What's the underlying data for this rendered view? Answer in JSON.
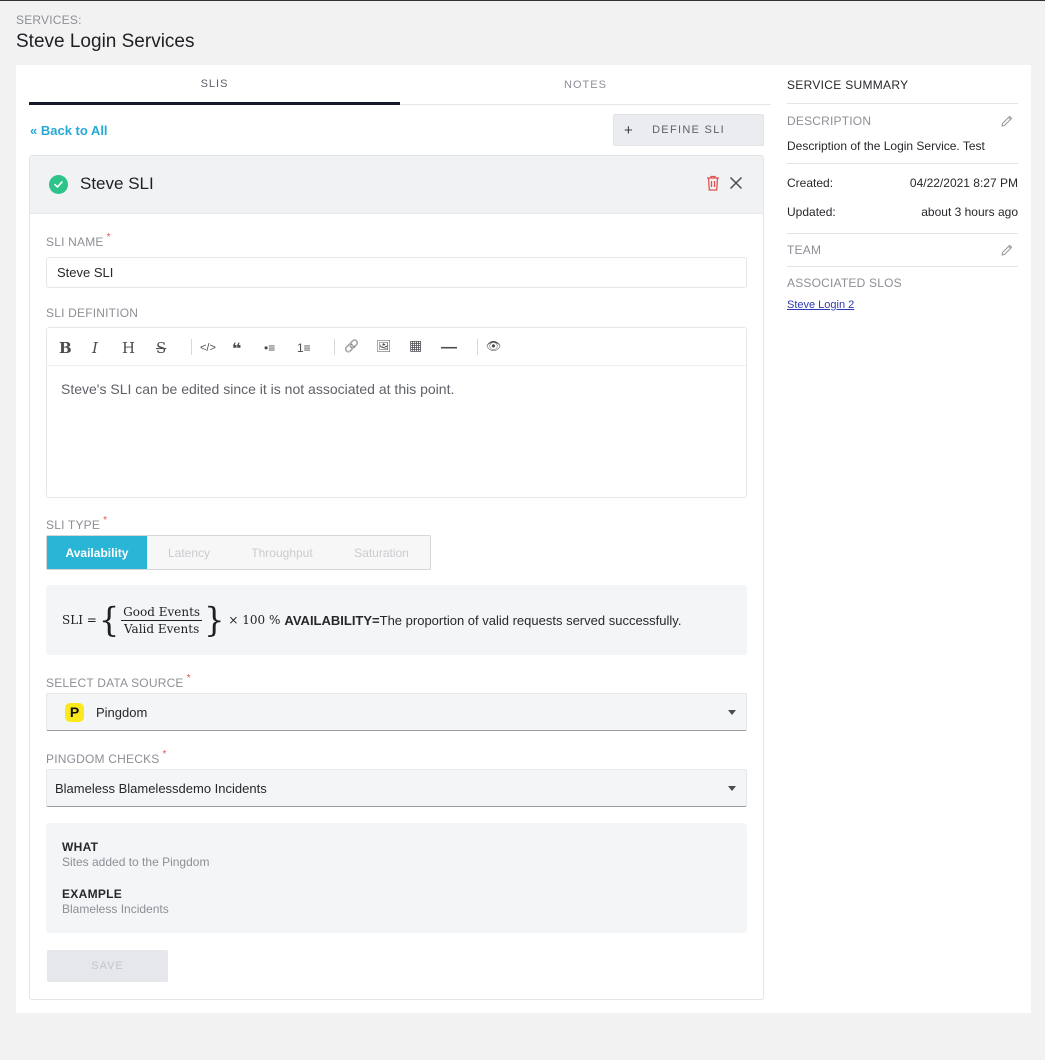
{
  "header": {
    "label": "SERVICES:",
    "title": "Steve Login Services"
  },
  "tabs": [
    {
      "label": "SLIS",
      "active": true
    },
    {
      "label": "NOTES",
      "active": false
    }
  ],
  "back_link": "« Back to All",
  "define_button": {
    "icon": "+",
    "label": "DEFINE SLI"
  },
  "sli_card": {
    "title": "Steve SLI",
    "status_icon": "check-circle-icon",
    "name_label": "SLI NAME",
    "name_value": "Steve SLI",
    "definition_label": "SLI DEFINITION",
    "toolbar": [
      "B",
      "I",
      "H",
      "S",
      "</>",
      "❝",
      "•≡",
      "1≡",
      "🔗",
      "🖼",
      "▦",
      "—",
      "👁"
    ],
    "definition_text": "Steve's SLI can be edited since it is not associated at this point.",
    "type_label": "SLI TYPE",
    "types": [
      {
        "label": "Availability",
        "active": true
      },
      {
        "label": "Latency",
        "active": false
      },
      {
        "label": "Throughput",
        "active": false
      },
      {
        "label": "Saturation",
        "active": false
      }
    ],
    "formula": {
      "lhs": "SLI =",
      "numerator": "Good Events",
      "denominator": "Valid Events",
      "multiplier": "× 100 %",
      "keyword": "AVAILABILITY=",
      "description": "The proportion of valid requests served successfully."
    },
    "data_source_label": "SELECT DATA SOURCE",
    "data_source_value": "Pingdom",
    "checks_label": "PINGDOM CHECKS",
    "checks_value": "Blameless Blamelessdemo Incidents",
    "info": {
      "what_label": "WHAT",
      "what_value": "Sites added to the Pingdom",
      "example_label": "EXAMPLE",
      "example_value": "Blameless Incidents"
    },
    "save_label": "SAVE"
  },
  "summary": {
    "title": "SERVICE SUMMARY",
    "description_label": "DESCRIPTION",
    "description_value": "Description of the Login Service. Test",
    "created_label": "Created:",
    "created_value": "04/22/2021 8:27 PM",
    "updated_label": "Updated:",
    "updated_value": "about 3 hours ago",
    "team_label": "TEAM",
    "slos_label": "ASSOCIATED SLOS",
    "slo_link": "Steve Login 2"
  },
  "colors": {
    "accent": "#29b5d6",
    "link": "#27a9d6",
    "success": "#2dc38b",
    "danger": "#e0534f",
    "pingdom": "#fbe91d"
  }
}
